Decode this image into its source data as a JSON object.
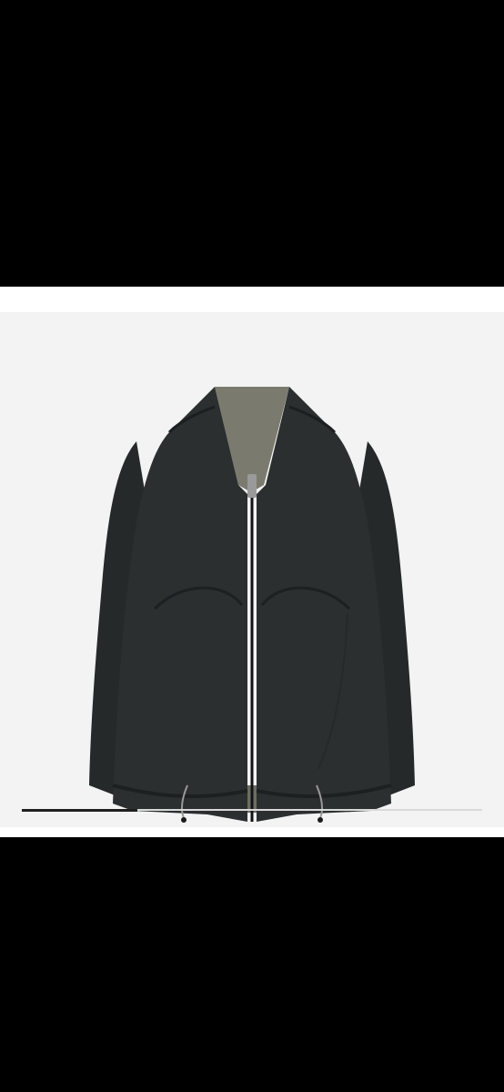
{
  "viewer": {
    "letterbox_color": "#000000",
    "frame_color": "#ffffff",
    "panel_color": "#f3f3f3"
  },
  "product": {
    "image_icon": "jacket-photo",
    "jacket_color": "#2a2d2d",
    "lining_color": "#7a7a6e"
  },
  "carousel": {
    "progress": 0.25,
    "track_color": "#d9d9d9",
    "fill_color": "#1f1f1f"
  }
}
